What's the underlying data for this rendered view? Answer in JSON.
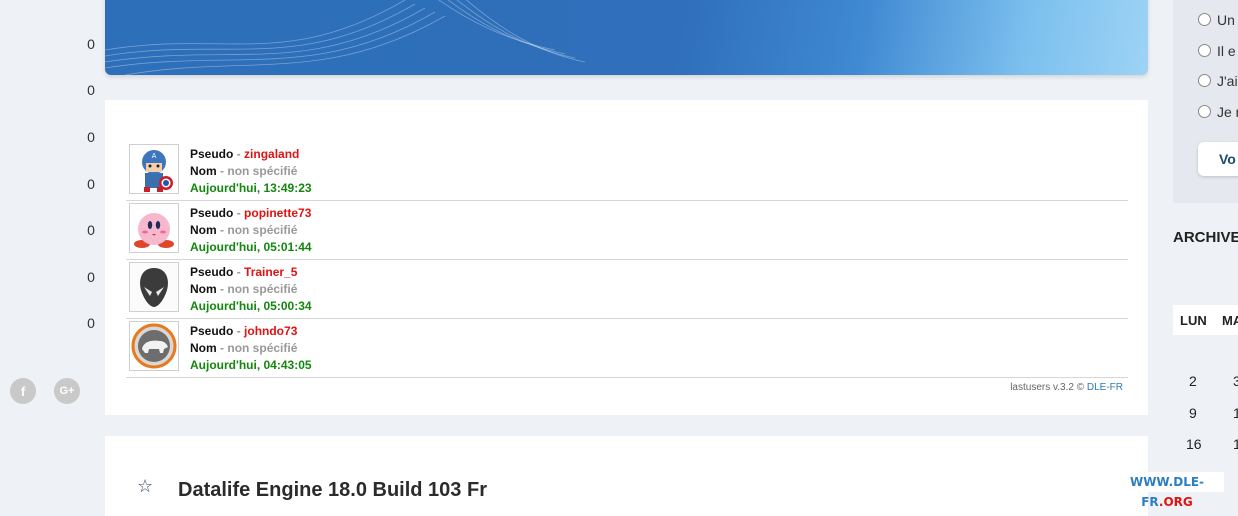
{
  "counters": [
    "0",
    "0",
    "0",
    "0",
    "0",
    "0",
    "0"
  ],
  "social": {
    "facebook": "f",
    "googleplus": "G+"
  },
  "lastusers": {
    "label_pseudo": "Pseudo",
    "label_nom": "Nom",
    "separator": "-",
    "users": [
      {
        "pseudo": "zingaland",
        "nom": "non spécifié",
        "when": "Aujourd'hui, 13:49:23",
        "avatar": "captain-america-avatar"
      },
      {
        "pseudo": "popinette73",
        "nom": "non spécifié",
        "when": "Aujourd'hui, 05:01:44",
        "avatar": "kirby-avatar"
      },
      {
        "pseudo": "Trainer_5",
        "nom": "non spécifié",
        "when": "Aujourd'hui, 05:00:34",
        "avatar": "alien-head-avatar"
      },
      {
        "pseudo": "johndo73",
        "nom": "non spécifié",
        "when": "Aujourd'hui, 04:43:05",
        "avatar": "animal-badge-avatar"
      }
    ],
    "credit_text": "lastusers v.3.2 ©",
    "credit_link": "DLE-FR"
  },
  "article": {
    "title": "Datalife Engine 18.0 Build 103 Fr"
  },
  "sidebar": {
    "poll_options": [
      "Un",
      "Il e",
      "J'ai",
      "Je n"
    ],
    "vote_label": "Vo",
    "archives_title": "ARCHIVE",
    "calendar_days": [
      "LUN",
      "MA"
    ],
    "calendar_col1": [
      "2",
      "9",
      "16"
    ],
    "calendar_col2": [
      "3",
      "1",
      "1"
    ]
  },
  "watermark": {
    "part1": "WWW.DLE-FR",
    "part2": ".ORG"
  },
  "colors": {
    "banner": "#2e6fb9",
    "pseudo": "#e01212",
    "date": "#14870f",
    "muted": "#999999"
  }
}
